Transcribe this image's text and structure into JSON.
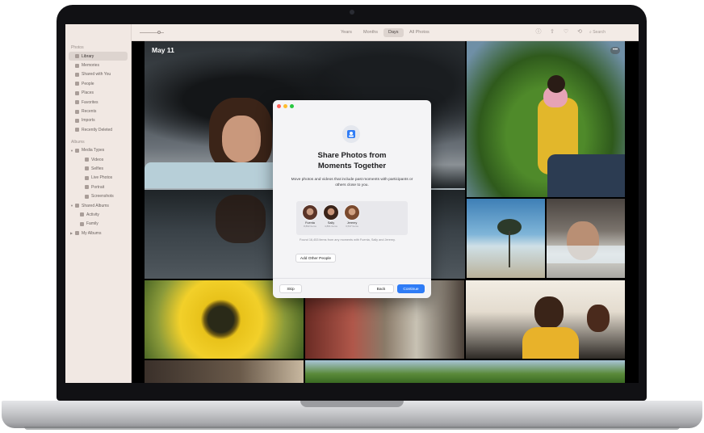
{
  "sidebar": {
    "sections": {
      "photos": "Photos",
      "albums": "Albums"
    },
    "library_items": [
      {
        "label": "Library",
        "icon": "photo-library-icon"
      },
      {
        "label": "Memories",
        "icon": "memories-icon"
      },
      {
        "label": "Shared with You",
        "icon": "shared-with-you-icon"
      },
      {
        "label": "People",
        "icon": "people-icon"
      },
      {
        "label": "Places",
        "icon": "places-icon"
      },
      {
        "label": "Favorites",
        "icon": "heart-icon"
      },
      {
        "label": "Recents",
        "icon": "clock-icon"
      },
      {
        "label": "Imports",
        "icon": "import-icon"
      },
      {
        "label": "Recently Deleted",
        "icon": "trash-icon"
      }
    ],
    "albums": {
      "media_types": "Media Types",
      "media_items": [
        "Videos",
        "Selfies",
        "Live Photos",
        "Portrait",
        "Screenshots"
      ],
      "shared_albums": "Shared Albums",
      "shared_items": [
        "Activity",
        "Family"
      ],
      "my_albums": "My Albums"
    }
  },
  "toolbar": {
    "segments": [
      "Years",
      "Months",
      "Days",
      "All Photos"
    ],
    "selected_segment": "Days",
    "search_placeholder": "Search",
    "icons": [
      "info-icon",
      "share-icon",
      "heart-icon",
      "rotate-icon"
    ]
  },
  "grid": {
    "date_label": "May 11",
    "more_button": "•••"
  },
  "dialog": {
    "title": "Share Photos from\nMoments Together",
    "body": "Move photos and videos that include past moments with participants or others close to you.",
    "people": [
      {
        "name": "Fuenta",
        "count": "8,862 Items",
        "color": "#7a4a3a"
      },
      {
        "name": "Sally",
        "count": "4,861 Items",
        "color": "#5a3a2e"
      },
      {
        "name": "Jeremy",
        "count": "3,537 Items",
        "color": "#8a5a40"
      }
    ],
    "found_text": "Found 16,453 items from any moments with Fuenta, Sally and Jeremy.",
    "add_people_button": "Add Other People",
    "skip_button": "Skip",
    "back_button": "Back",
    "continue_button": "Continue"
  },
  "colors": {
    "accent": "#2f7cf6",
    "sidebar_bg": "#f1e8e3",
    "toolbar_bg": "#f3ebe6",
    "close": "#ff5f57",
    "minimize": "#febc2e",
    "zoom": "#28c840"
  }
}
